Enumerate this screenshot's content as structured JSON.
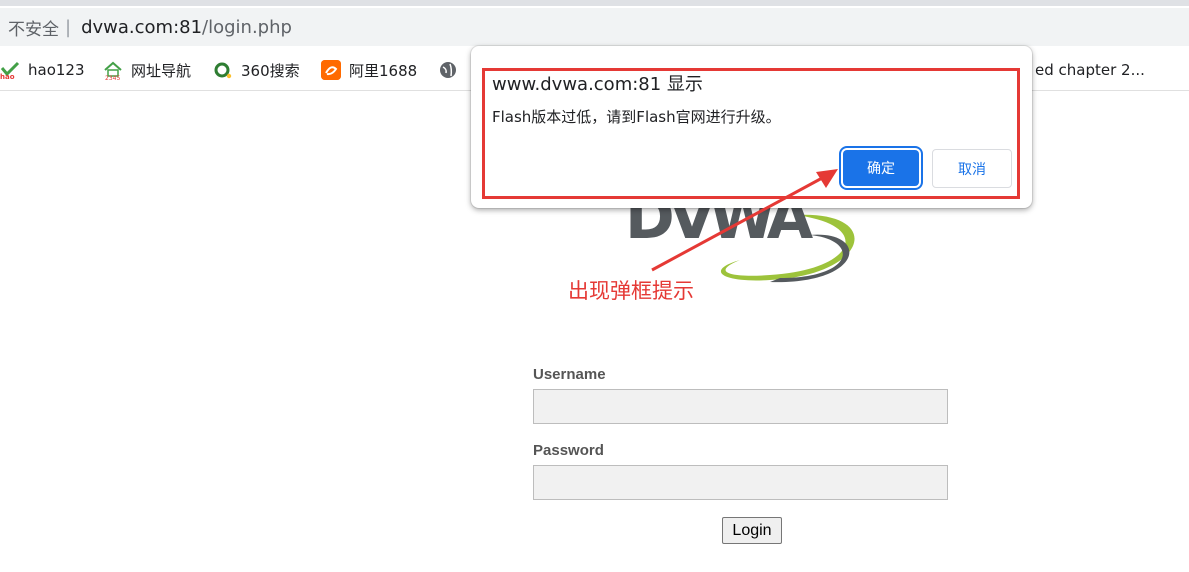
{
  "browser": {
    "security_label": "不安全",
    "separator": "|",
    "url_host": "dvwa.com:81",
    "url_path": "/login.php"
  },
  "bookmarks": [
    {
      "label": "hao123",
      "icon": "hao123-icon"
    },
    {
      "label": "网址导航",
      "icon": "house-2345-icon"
    },
    {
      "label": "360搜索",
      "icon": "360-search-icon"
    },
    {
      "label": "阿里1688",
      "icon": "alibaba-icon"
    },
    {
      "label": "",
      "icon": "globe-icon"
    }
  ],
  "bookmark_truncated": "ed chapter 2...",
  "dialog": {
    "title": "www.dvwa.com:81 显示",
    "message": "Flash版本过低，请到Flash官网进行升级。",
    "ok_label": "确定",
    "cancel_label": "取消"
  },
  "annotation": {
    "text": "出现弹框提示",
    "color": "#e53935"
  },
  "login_form": {
    "username_label": "Username",
    "username_value": "",
    "password_label": "Password",
    "password_value": "",
    "login_label": "Login"
  },
  "colors": {
    "accent": "#1a73e8",
    "annotation": "#e53935",
    "logo_green": "#9dc33b",
    "logo_gray": "#555a5e"
  }
}
